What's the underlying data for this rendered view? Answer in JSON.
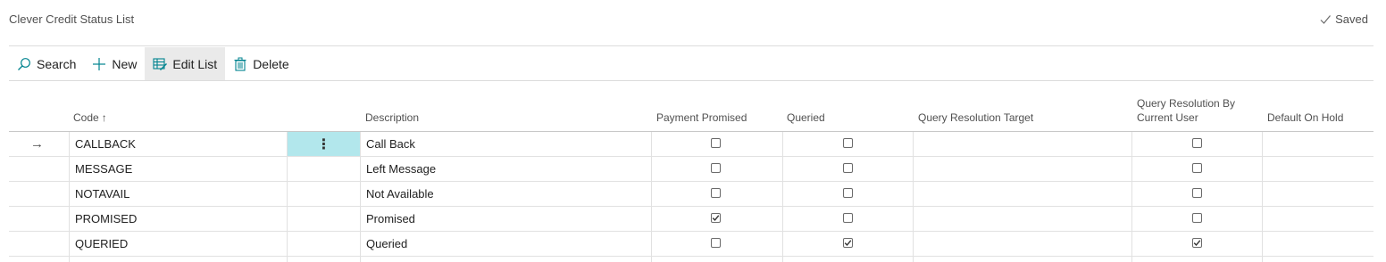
{
  "page": {
    "title": "Clever Credit Status List",
    "saved_label": "Saved"
  },
  "toolbar": {
    "search_label": "Search",
    "new_label": "New",
    "edit_list_label": "Edit List",
    "delete_label": "Delete"
  },
  "table": {
    "headers": {
      "code": "Code",
      "description": "Description",
      "payment_promised": "Payment Promised",
      "queried": "Queried",
      "query_resolution_target": "Query Resolution Target",
      "query_resolution_by_current_user_line1": "Query Resolution By",
      "query_resolution_by_current_user_line2": "Current User",
      "default_on_hold": "Default On Hold"
    },
    "sort_indicator": "↑",
    "current_row_indicator": "→",
    "row_actions_glyph": "⋮",
    "rows": [
      {
        "code": "CALLBACK",
        "description": "Call Back",
        "payment_promised": false,
        "queried": false,
        "query_resolution_target": "",
        "query_resolution_by_current_user": false,
        "default_on_hold": ""
      },
      {
        "code": "MESSAGE",
        "description": "Left Message",
        "payment_promised": false,
        "queried": false,
        "query_resolution_target": "",
        "query_resolution_by_current_user": false,
        "default_on_hold": ""
      },
      {
        "code": "NOTAVAIL",
        "description": "Not Available",
        "payment_promised": false,
        "queried": false,
        "query_resolution_target": "",
        "query_resolution_by_current_user": false,
        "default_on_hold": ""
      },
      {
        "code": "PROMISED",
        "description": "Promised",
        "payment_promised": true,
        "queried": false,
        "query_resolution_target": "",
        "query_resolution_by_current_user": false,
        "default_on_hold": ""
      },
      {
        "code": "QUERIED",
        "description": "Queried",
        "payment_promised": false,
        "queried": true,
        "query_resolution_target": "",
        "query_resolution_by_current_user": true,
        "default_on_hold": ""
      }
    ]
  },
  "colors": {
    "accent": "#00838f",
    "selected_cell": "#b2e7ec",
    "toolbar_active": "#eaeaea"
  },
  "icons": {
    "saved": "checkmark-icon",
    "search": "search-icon",
    "new": "plus-icon",
    "edit_list": "edit-list-icon",
    "delete": "trash-icon"
  }
}
